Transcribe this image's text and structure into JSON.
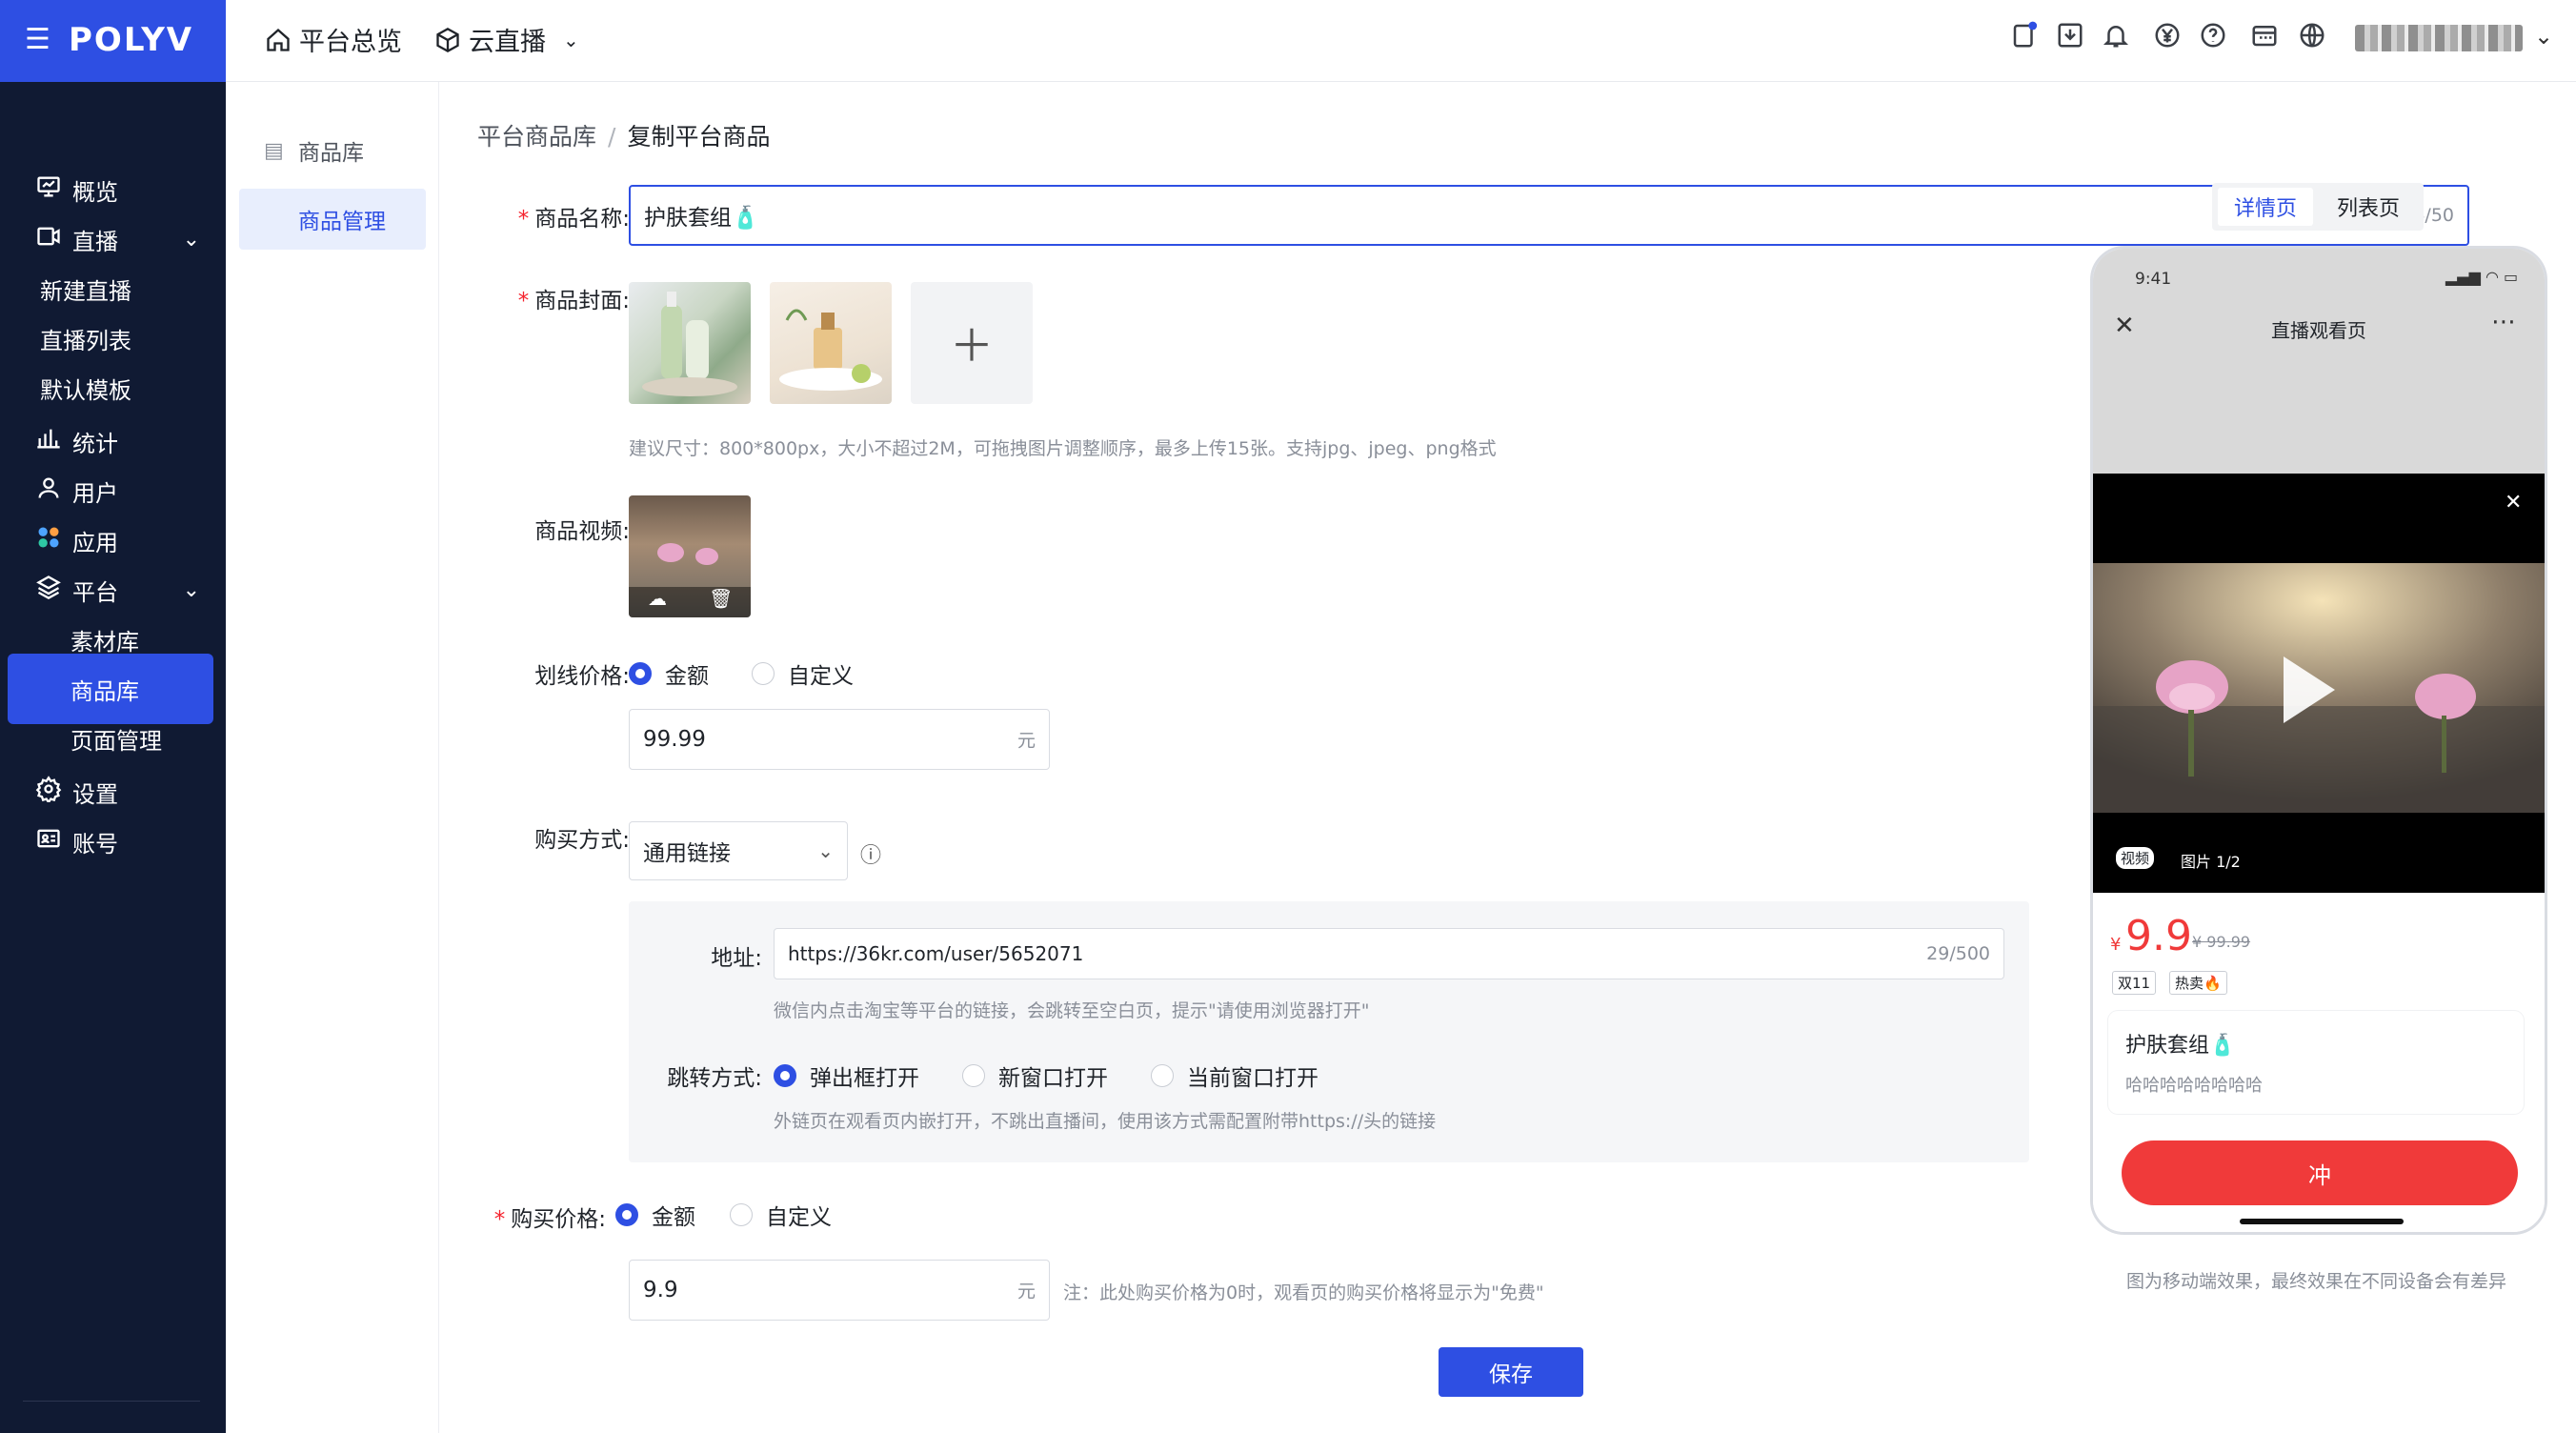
{
  "brand": {
    "logo": "POLYV",
    "menu_icon": "menu-icon"
  },
  "topbar": {
    "nav": [
      {
        "label": "平台总览",
        "icon": "home-icon"
      },
      {
        "label": "云直播",
        "icon": "cube-icon"
      }
    ],
    "icons": [
      "clipboard-check-icon",
      "download-icon",
      "bell-icon",
      "yen-icon",
      "help-icon",
      "calendar-icon",
      "globe-icon"
    ]
  },
  "sidebar": {
    "items": [
      {
        "label": "概览",
        "icon": "monitor-icon"
      },
      {
        "label": "直播",
        "icon": "video-icon"
      },
      {
        "label": "新建直播"
      },
      {
        "label": "直播列表"
      },
      {
        "label": "默认模板"
      },
      {
        "label": "统计",
        "icon": "bar-chart-icon"
      },
      {
        "label": "用户",
        "icon": "user-icon"
      },
      {
        "label": "应用",
        "icon": "apps-icon"
      },
      {
        "label": "平台",
        "icon": "layers-icon"
      },
      {
        "label": "素材库"
      },
      {
        "label": "商品库"
      },
      {
        "label": "页面管理"
      },
      {
        "label": "设置",
        "icon": "settings-icon"
      },
      {
        "label": "账号",
        "icon": "id-card-icon"
      }
    ]
  },
  "submenu": {
    "items": [
      {
        "label": "商品库"
      },
      {
        "label": "商品管理"
      }
    ]
  },
  "breadcrumb": {
    "parent": "平台商品库",
    "separator": "/",
    "current": "复制平台商品"
  },
  "form": {
    "name": {
      "label": "商品名称:",
      "value": "护肤套组🧴",
      "count": "6/50"
    },
    "cover": {
      "label": "商品封面:",
      "hint": "建议尺寸：800*800px，大小不超过2M，可拖拽图片调整顺序，最多上传15张。支持jpg、jpeg、png格式"
    },
    "video": {
      "label": "商品视频:"
    },
    "strike_price": {
      "label": "划线价格:",
      "opt_amount": "金额",
      "opt_custom": "自定义",
      "value": "99.99",
      "unit": "元"
    },
    "buy_method": {
      "label": "购买方式:",
      "select": "通用链接",
      "address_label": "地址:",
      "address": "https://36kr.com/user/5652071",
      "address_count": "29/500",
      "address_hint": "微信内点击淘宝等平台的链接，会跳转至空白页，提示\"请使用浏览器打开\"",
      "jump_label": "跳转方式:",
      "jump_opts": [
        "弹出框打开",
        "新窗口打开",
        "当前窗口打开"
      ],
      "jump_hint": "外链页在观看页内嵌打开，不跳出直播间，使用该方式需配置附带https://头的链接"
    },
    "buy_price": {
      "label": "购买价格:",
      "opt_amount": "金额",
      "opt_custom": "自定义",
      "value": "9.9",
      "unit": "元",
      "note": "注：此处购买价格为0时，观看页的购买价格将显示为\"免费\""
    },
    "save": "保存"
  },
  "preview": {
    "tabs": [
      "详情页",
      "列表页"
    ],
    "status_time": "9:41",
    "title": "直播观看页",
    "media_tag_video": "视频",
    "media_tag_image": "图片 1/2",
    "currency": "¥",
    "price": "9.9",
    "orig_price": "¥ 99.99",
    "tags": [
      "双11",
      "热卖🔥"
    ],
    "product_name": "护肤套组🧴",
    "product_desc": "哈哈哈哈哈哈哈哈",
    "cta": "冲",
    "note": "图为移动端效果，最终效果在不同设备会有差异"
  },
  "colors": {
    "accent": "#2e4fe3",
    "sidebar": "#101a33",
    "cta": "#f03a3a"
  }
}
